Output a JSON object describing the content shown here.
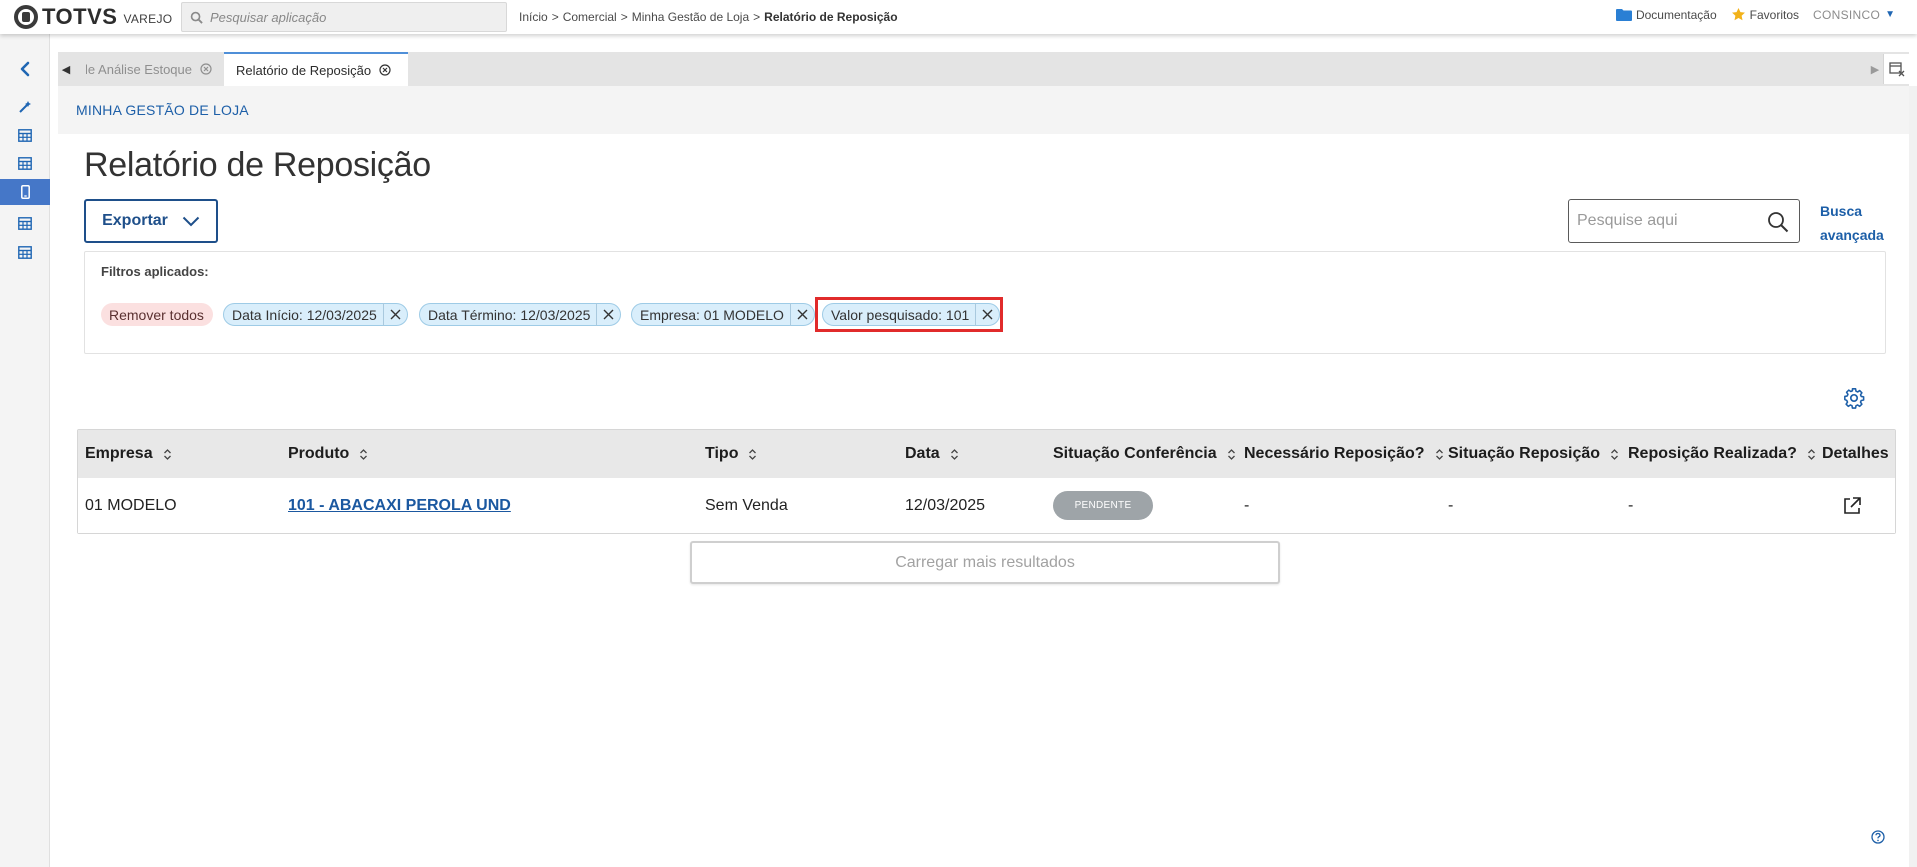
{
  "topbar": {
    "brand": "TOTVS",
    "brand_sub": "VAREJO",
    "search_placeholder": "Pesquisar aplicação",
    "breadcrumb": [
      "Início",
      "Comercial",
      "Minha Gestão de Loja"
    ],
    "breadcrumb_current": "Relatório de Reposição",
    "breadcrumb_sep": ">",
    "documentation": "Documentação",
    "favorites": "Favoritos",
    "user": "CONSINCO"
  },
  "tabs": {
    "tab1_label": "Ordem de Análise Estoque",
    "tab2_label": "Relatório de Reposição"
  },
  "section_header": "MINHA GESTÃO DE LOJA",
  "page_title": "Relatório de Reposição",
  "toolbar": {
    "export_label": "Exportar",
    "search_placeholder": "Pesquise aqui",
    "advanced_search_line1": "Busca",
    "advanced_search_line2": "avançada"
  },
  "filters": {
    "label": "Filtros aplicados:",
    "remove_all": "Remover todos",
    "chips": [
      "Data Início: 12/03/2025",
      "Data Término: 12/03/2025",
      "Empresa: 01 MODELO",
      "Valor pesquisado: 101"
    ]
  },
  "table": {
    "headers": [
      "Empresa",
      "Produto",
      "Tipo",
      "Data",
      "Situação Conferência",
      "Necessário Reposição?",
      "Situação Reposição",
      "Reposição Realizada?",
      "Detalhes"
    ],
    "rows": [
      {
        "empresa": "01 MODELO",
        "produto": "101 - ABACAXI PEROLA UND",
        "tipo": "Sem Venda",
        "data": "12/03/2025",
        "situacao_conferencia": "PENDENTE",
        "necessario_reposicao": "-",
        "situacao_reposicao": "-",
        "reposicao_realizada": "-"
      }
    ]
  },
  "load_more_label": "Carregar mais resultados",
  "colors": {
    "primary": "#1d5fa8",
    "sidebar_active": "#4577c8",
    "chip_bg": "#d9eefb",
    "remove_chip_bg": "#fbe0e0",
    "highlight": "#e12b2b",
    "badge_grey": "#9ea4a8"
  }
}
